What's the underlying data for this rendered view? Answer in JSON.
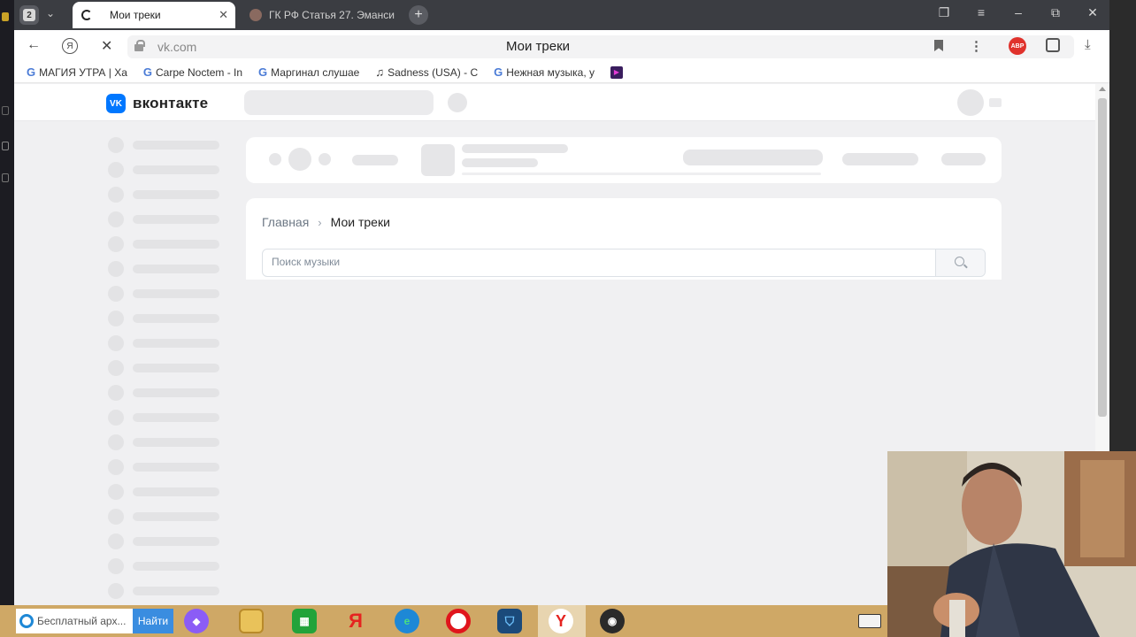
{
  "browser": {
    "tab_count": "2",
    "tabs": [
      {
        "title": "Мои треки",
        "close": "✕"
      },
      {
        "title": "ГК РФ Статья 27. Эманси"
      }
    ],
    "new_tab_icon": "plus-icon",
    "window_controls": [
      "collections-icon",
      "menu-icon",
      "minimize-icon",
      "restore-icon",
      "close-icon"
    ],
    "address": {
      "url": "vk.com",
      "page_title": "Мои треки"
    },
    "extensions": {
      "abp_label": "ABP"
    },
    "bookmarks": [
      {
        "label": "МАГИЯ УТРА | Ха",
        "icon": "google-icon"
      },
      {
        "label": "Carpe Noctem - In",
        "icon": "google-icon"
      },
      {
        "label": "Маргинал слушае",
        "icon": "google-icon"
      },
      {
        "label": "Sadness (USA) - C",
        "icon": "music-note-icon"
      },
      {
        "label": "Нежная музыка, у",
        "icon": "google-icon"
      }
    ]
  },
  "vk": {
    "logo_text": "вконтакте",
    "logo_badge": "VK",
    "breadcrumb": {
      "home": "Главная",
      "separator": "›",
      "current": "Мои треки"
    },
    "search": {
      "placeholder": "Поиск музыки",
      "value": ""
    }
  },
  "taskbar": {
    "search_text": "Бесплатный арх...",
    "find_label": "Найти",
    "apps": [
      "alice-icon",
      "file-explorer-icon",
      "store-icon",
      "yandex-icon",
      "edge-icon",
      "opera-icon",
      "vpn-shield-icon",
      "yandex-browser-icon",
      "obs-icon"
    ],
    "keyboard_icon": "keyboard-icon"
  },
  "colors": {
    "vk_blue": "#0077ff",
    "taskbar": "#cfa866",
    "tabbar": "#3b3d42",
    "abp_red": "#e0322c"
  }
}
